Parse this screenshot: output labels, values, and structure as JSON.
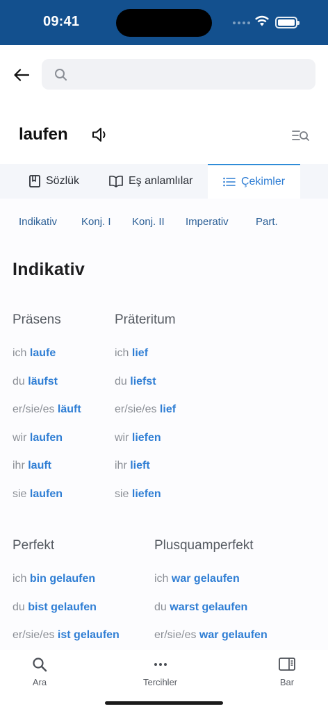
{
  "status": {
    "time": "09:41"
  },
  "search": {
    "placeholder": ""
  },
  "word": {
    "title": "laufen"
  },
  "tabs": [
    {
      "label": "Sözlük"
    },
    {
      "label": "Eş anlamlılar"
    },
    {
      "label": "Çekimler"
    }
  ],
  "moods": [
    "Indikativ",
    "Konj. I",
    "Konj. II",
    "Imperativ",
    "Part."
  ],
  "section_title": "Indikativ",
  "tenses": {
    "praesens": {
      "title": "Präsens",
      "rows": [
        {
          "pron": "ich",
          "verb": "laufe"
        },
        {
          "pron": "du",
          "verb": "läufst"
        },
        {
          "pron": "er/sie/es",
          "verb": "läuft"
        },
        {
          "pron": "wir",
          "verb": "laufen"
        },
        {
          "pron": "ihr",
          "verb": "lauft"
        },
        {
          "pron": "sie",
          "verb": "laufen"
        }
      ]
    },
    "praeteritum": {
      "title": "Präteritum",
      "rows": [
        {
          "pron": "ich",
          "verb": "lief"
        },
        {
          "pron": "du",
          "verb": "liefst"
        },
        {
          "pron": "er/sie/es",
          "verb": "lief"
        },
        {
          "pron": "wir",
          "verb": "liefen"
        },
        {
          "pron": "ihr",
          "verb": "lieft"
        },
        {
          "pron": "sie",
          "verb": "liefen"
        }
      ]
    },
    "perfekt": {
      "title": "Perfekt",
      "rows": [
        {
          "pron": "ich",
          "verb": "bin gelaufen"
        },
        {
          "pron": "du",
          "verb": "bist gelaufen"
        },
        {
          "pron": "er/sie/es",
          "verb": "ist gelaufen"
        }
      ]
    },
    "plusquamperfekt": {
      "title": "Plusquamperfekt",
      "rows": [
        {
          "pron": "ich",
          "verb": "war gelaufen"
        },
        {
          "pron": "du",
          "verb": "warst gelaufen"
        },
        {
          "pron": "er/sie/es",
          "verb": "war gelaufen"
        }
      ]
    }
  },
  "bottom_nav": [
    {
      "label": "Ara",
      "icon": "search-icon"
    },
    {
      "label": "Tercihler",
      "icon": "more-icon"
    },
    {
      "label": "Bar",
      "icon": "sidebar-icon"
    }
  ],
  "colors": {
    "status_bar": "#13508e",
    "accent": "#2f7ed4"
  }
}
